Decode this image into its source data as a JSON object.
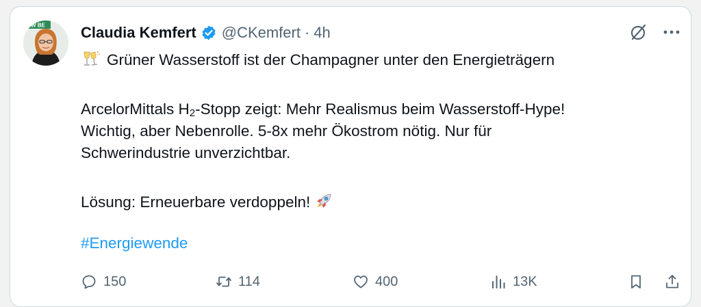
{
  "tweet": {
    "author_name": "Claudia Kemfert",
    "handle": "@CKemfert",
    "separator": "·",
    "time": "4h",
    "line1": "Grüner Wasserstoff ist der Champagner unter den Energieträgern",
    "line2_pre": "ArcelorMittals H",
    "line2_sub": "2",
    "line2_post": "-Stopp zeigt: Mehr Realismus beim Wasserstoff-Hype!",
    "line3": "Wichtig, aber Nebenrolle. 5-8x mehr Ökostrom nötig. Nur für",
    "line4": "Schwerindustrie unverzichtbar.",
    "line5": "Lösung: Erneuerbare verdoppeln!",
    "hashtag": "#Energiewende",
    "avatar_logo_text": "DIW BE"
  },
  "actions": {
    "replies": "150",
    "reposts": "114",
    "likes": "400",
    "views": "13K"
  },
  "icons": {
    "verified": "verified-badge-icon",
    "champagne": "champagne-emoji-icon",
    "rocket": "rocket-emoji-icon",
    "grok": "grok-icon",
    "more": "more-options-icon",
    "reply": "reply-icon",
    "repost": "repost-icon",
    "like": "heart-icon",
    "views": "views-icon",
    "bookmark": "bookmark-icon",
    "share": "share-icon"
  },
  "colors": {
    "link": "#1d9bf0",
    "secondary_text": "#536471",
    "primary_text": "#0f1419",
    "border": "#cfd9de"
  }
}
